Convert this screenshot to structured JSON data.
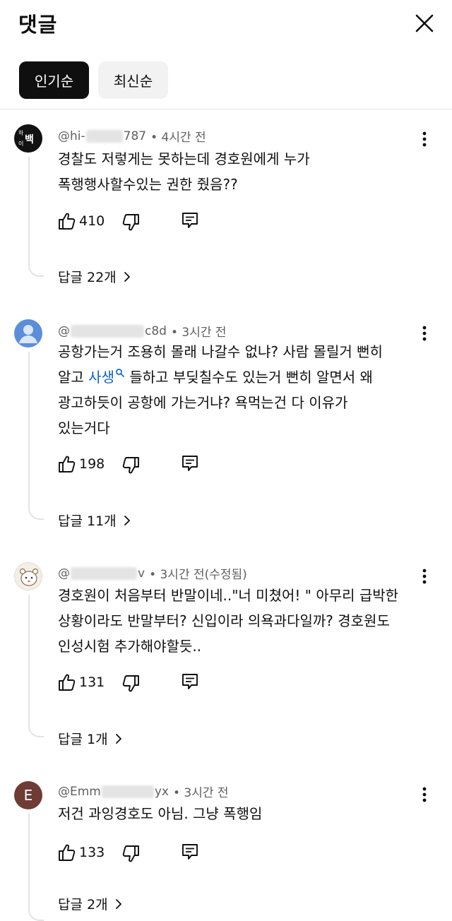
{
  "header": {
    "title": "댓글"
  },
  "sort": {
    "popular": "인기순",
    "latest": "최신순"
  },
  "comments": [
    {
      "author_prefix": "@hi-",
      "author_suffix": "787",
      "time": "• 4시간 전",
      "avatar_text": "하이백",
      "lines": [
        "경찰도 저렇게는 못하는데 경호원에게 누가",
        "폭행행사할수있는 권한 줬음??"
      ],
      "likes": "410",
      "replies": "답글 22개"
    },
    {
      "author_prefix": "@",
      "author_suffix": "c8d",
      "time": "• 3시간 전",
      "lines": [
        "공항가는거 조용히 몰래 나갈수  없냐? 사람 몰릴거 뻔히",
        "광고하듯이 공항에 가는거냐? 욕먹는건 다 이유가",
        "있는거다"
      ],
      "line2_pre": "알고 ",
      "line2_link": "사생",
      "line2_post": " 들하고 부딪칠수도 있는거 뻔히 알면서 왜",
      "likes": "198",
      "replies": "답글 11개"
    },
    {
      "author_prefix": "@",
      "author_suffix": "v",
      "time": "• 3시간 전(수정됨)",
      "lines": [
        "경호원이 처음부터 반말이네..\"너 미쳤어! \" 아무리 급박한",
        "상황이라도 반말부터? 신입이라 의욕과다일까? 경호원도",
        "인성시험 추가해야할듯.."
      ],
      "likes": "131",
      "replies": "답글 1개"
    },
    {
      "author_prefix": "@Emm",
      "author_suffix": "yx",
      "time": "• 3시간 전",
      "avatar_text": "E",
      "lines": [
        "저건 과잉경호도 아님. 그냥 폭행임"
      ],
      "likes": "133",
      "replies": "답글 2개"
    }
  ]
}
